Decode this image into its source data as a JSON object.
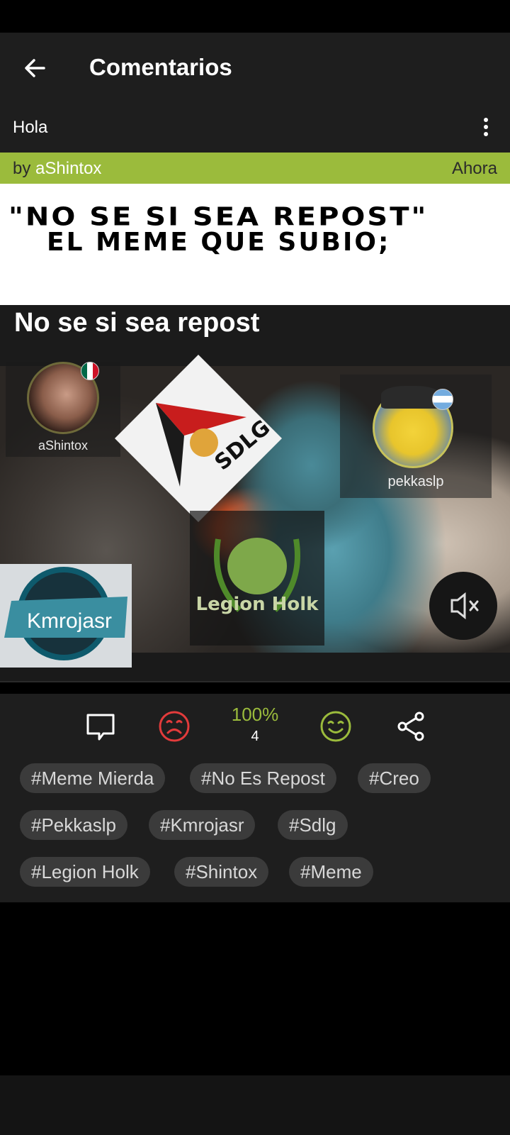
{
  "appbar": {
    "title": "Comentarios",
    "back_icon": "arrow-left-icon"
  },
  "post": {
    "title": "Hola",
    "by_prefix": "by",
    "author": "aShintox",
    "time": "Ahora",
    "more_icon": "more-vertical-icon"
  },
  "meme": {
    "caption_line1": "\"No se si sea repost\"",
    "caption_line2": "el meme que subio;",
    "video_title": "No se si sea repost",
    "user_left": "aShintox",
    "user_right": "pekkaslp",
    "kmrojasr_label": "Kmrojasr",
    "sdlg_label": "SDLG",
    "legion_label": "Legion Holk",
    "mute_icon": "volume-mute-icon"
  },
  "actions": {
    "score_pct": "100%",
    "score_count": "4",
    "comment_icon": "comment-icon",
    "dislike_icon": "sad-face-icon",
    "like_icon": "smile-face-icon",
    "share_icon": "share-icon",
    "colors": {
      "accent": "#9bbb3c",
      "dislike": "#e23b3b"
    }
  },
  "tags": [
    "#Meme Mierda",
    "#No Es Repost",
    "#Creo",
    "#Pekkaslp",
    "#Kmrojasr",
    "#Sdlg",
    "#Legion Holk",
    "#Shintox",
    "#Meme"
  ]
}
